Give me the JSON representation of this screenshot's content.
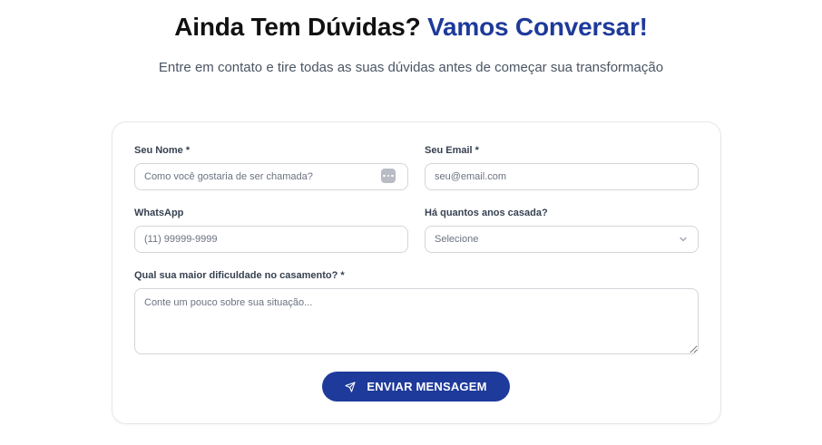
{
  "header": {
    "title_main": "Ainda Tem Dúvidas?",
    "title_accent": "Vamos Conversar!",
    "subtitle": "Entre em contato e tire todas as suas dúvidas antes de começar sua transformação"
  },
  "form": {
    "name": {
      "label": "Seu Nome *",
      "placeholder": "Como você gostaria de ser chamada?",
      "value": ""
    },
    "email": {
      "label": "Seu Email *",
      "placeholder": "seu@email.com",
      "value": ""
    },
    "whatsapp": {
      "label": "WhatsApp",
      "placeholder": "(11) 99999-9999",
      "value": ""
    },
    "years_married": {
      "label": "Há quantos anos casada?",
      "selected": "Selecione"
    },
    "difficulty": {
      "label": "Qual sua maior dificuldade no casamento? *",
      "placeholder": "Conte um pouco sobre sua situação...",
      "value": ""
    },
    "submit_label": "ENVIAR MENSAGEM"
  },
  "icons": {
    "name_field_badge": "password-manager-icon",
    "select_arrow": "chevron-down-icon",
    "submit": "send-icon"
  },
  "colors": {
    "accent": "#1e3a9a",
    "border": "#d1d5db",
    "card_border": "#e5e7eb"
  }
}
